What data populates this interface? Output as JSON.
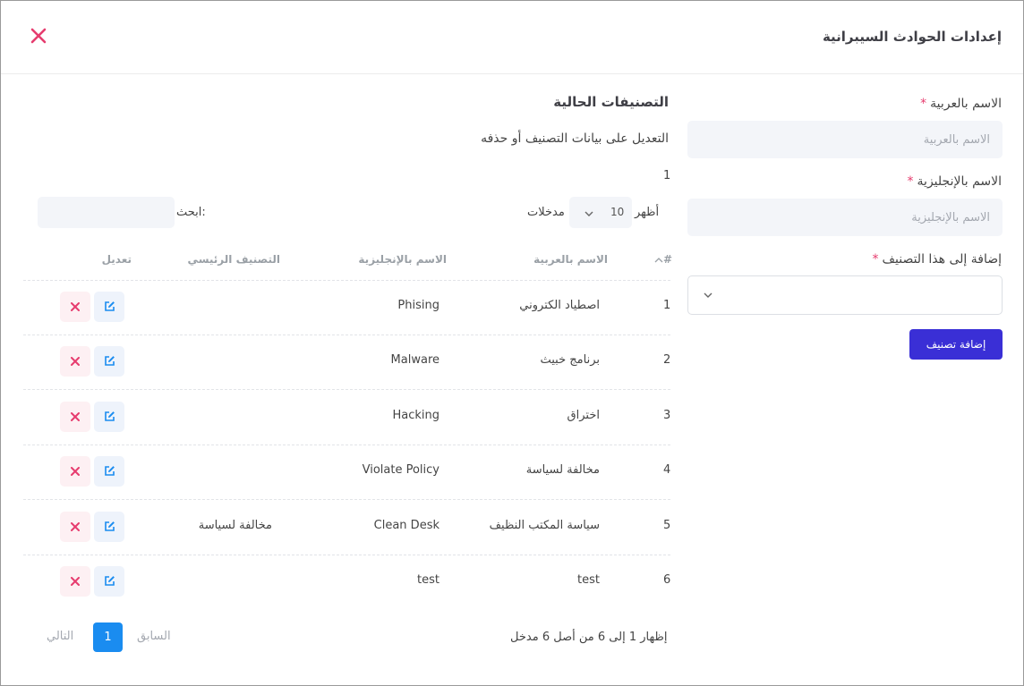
{
  "modal": {
    "title": "إعدادات الحوادث السيبرانية"
  },
  "form": {
    "name_ar_label": "الاسم بالعربية",
    "name_ar_placeholder": "الاسم بالعربية",
    "name_en_label": "الاسم بالإنجليزية",
    "name_en_placeholder": "الاسم بالإنجليزية",
    "parent_label": "إضافة إلى هذا التصنيف",
    "parent_value": "",
    "required_mark": "*",
    "submit_label": "إضافة تصنيف"
  },
  "categories": {
    "title": "التصنيفات الحالية",
    "subtitle": "التعديل على بيانات التصنيف أو حذفه",
    "top_number": "1",
    "show_label": "أظهر",
    "page_length": "10",
    "entries_label": "مدخلات",
    "search_label": "ابحث:",
    "headers": {
      "index": "#",
      "name_ar": "الاسم بالعربية",
      "name_en": "الاسم بالإنجليزية",
      "parent": "التصنيف الرئيسي",
      "edit": "تعديل"
    },
    "rows": [
      {
        "index": "1",
        "name_ar": "اصطياد الكتروني",
        "name_en": "Phising",
        "parent": ""
      },
      {
        "index": "2",
        "name_ar": "برنامج خبيث",
        "name_en": "Malware",
        "parent": ""
      },
      {
        "index": "3",
        "name_ar": "اختراق",
        "name_en": "Hacking",
        "parent": ""
      },
      {
        "index": "4",
        "name_ar": "مخالفة لسياسة",
        "name_en": "Violate Policy",
        "parent": ""
      },
      {
        "index": "5",
        "name_ar": "سياسة المكتب النظيف",
        "name_en": "Clean Desk",
        "parent": "مخالفة لسياسة"
      },
      {
        "index": "6",
        "name_ar": "test",
        "name_en": "test",
        "parent": ""
      }
    ],
    "info": "إظهار 1 إلى 6 من أصل 6 مدخل",
    "pagination": {
      "previous": "السابق",
      "current": "1",
      "next": "التالي"
    }
  },
  "colors": {
    "primary": "#3a2fd6",
    "page_active": "#1a8cf0",
    "danger": "#e63c6e",
    "edit_icon": "#1a8cf0"
  },
  "icons": {
    "close": "close-icon",
    "chevron": "chevron-down-icon",
    "edit": "edit-icon",
    "delete": "close-icon",
    "sort": "sort-icon"
  }
}
